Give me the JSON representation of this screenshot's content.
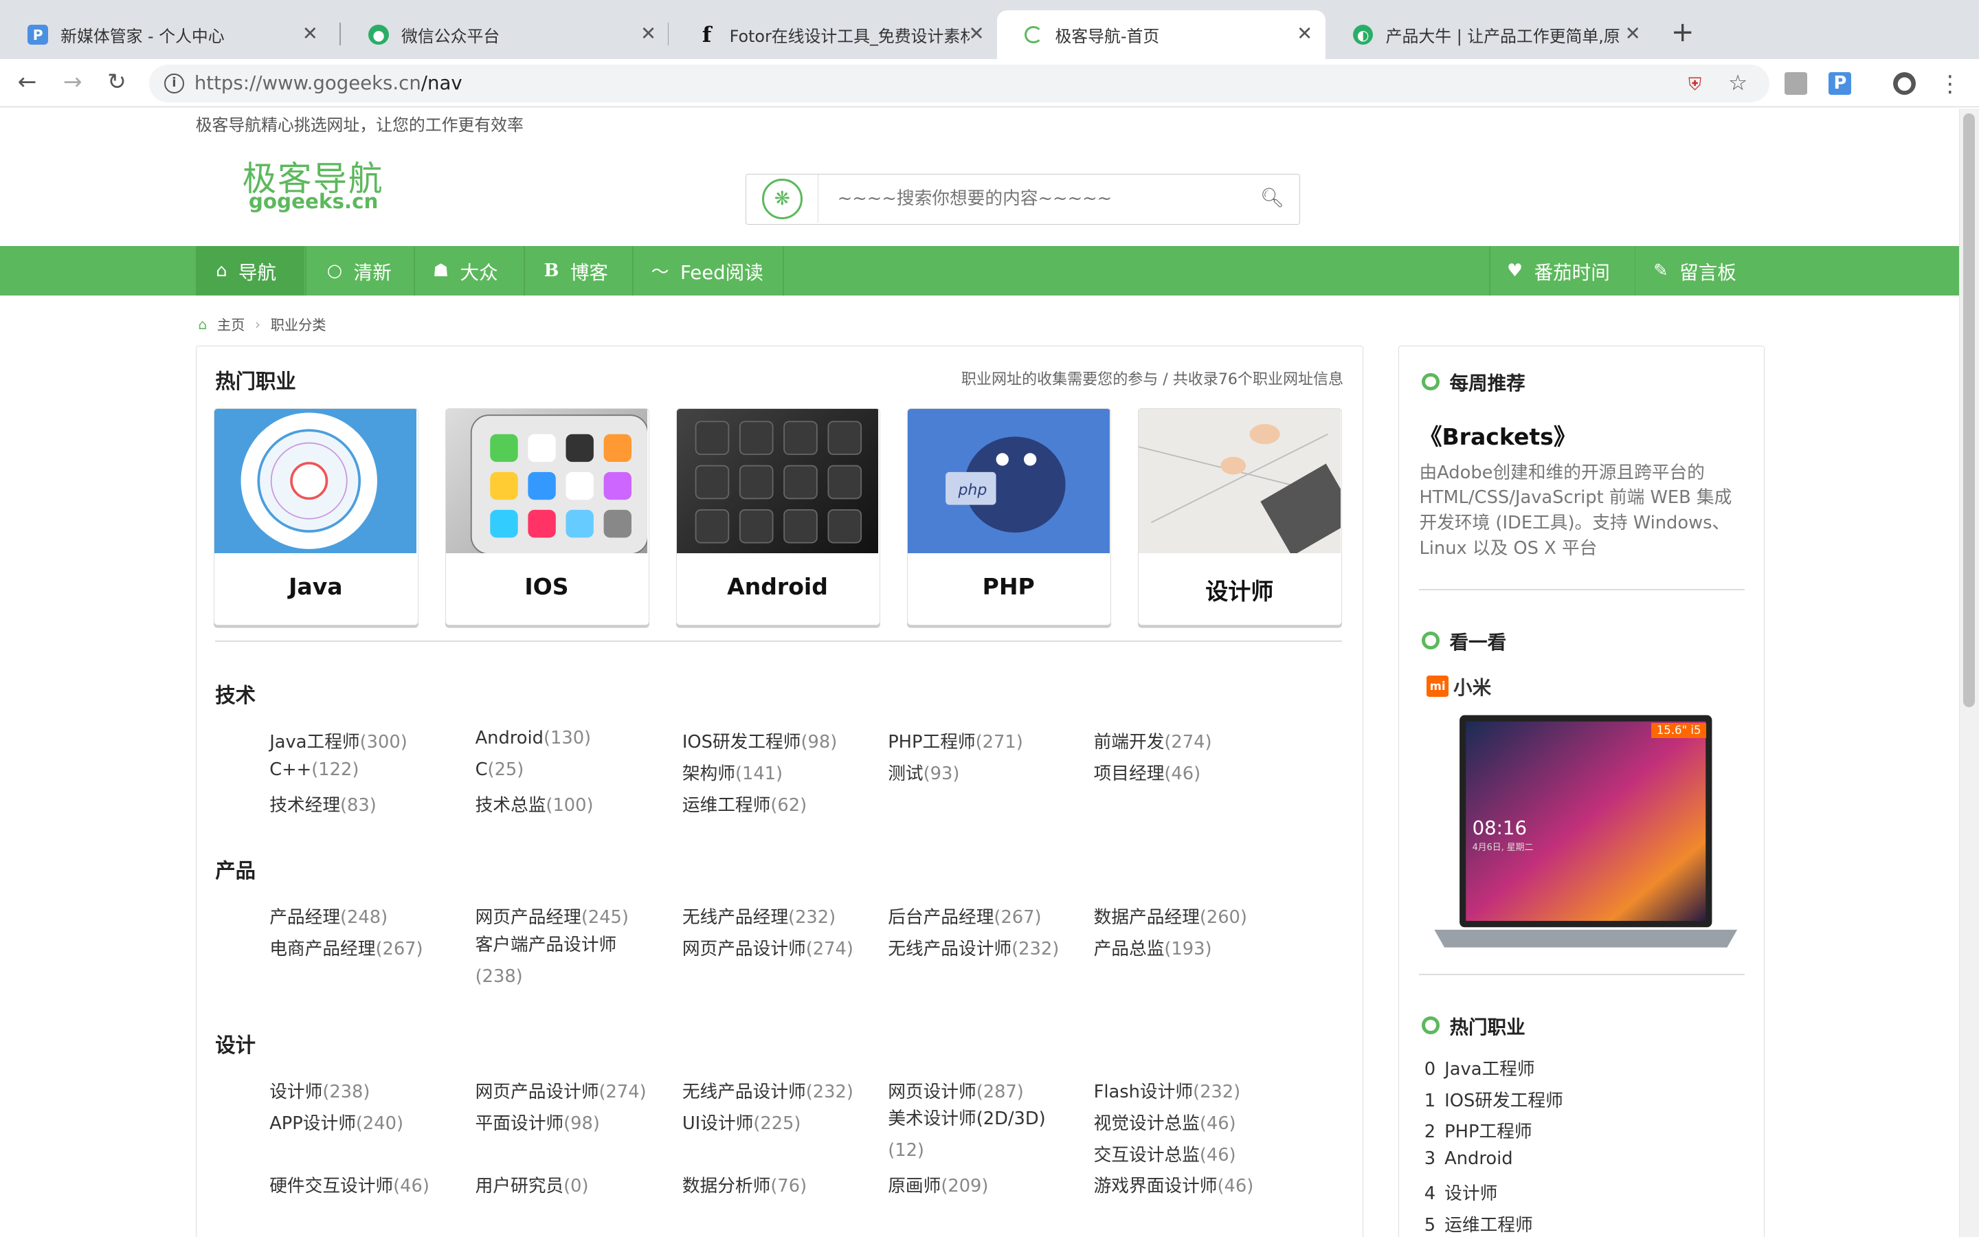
{
  "browser": {
    "tabs": [
      {
        "title": "新媒体管家 - 个人中心",
        "icon": "P",
        "color": "#4a90e2"
      },
      {
        "title": "微信公众平台",
        "icon": "wechat",
        "color": "#2aae67"
      },
      {
        "title": "Fotor在线设计工具_免费设计素材",
        "icon": "f",
        "color": "#111111"
      },
      {
        "title": "极客导航-首页",
        "icon": "loading",
        "color": "#5cb85c"
      },
      {
        "title": "产品大牛 | 让产品工作更简单,原",
        "icon": "pd",
        "color": "#2aae67"
      }
    ],
    "url_host": "https://www.gogeeks.cn",
    "url_path": "/nav"
  },
  "header": {
    "slogan": "极客导航精心挑选网址，让您的工作更有效率",
    "logo_cn": "极客导航",
    "logo_en": "gogeeks.cn",
    "search_placeholder": "~~~~搜索你想要的内容~~~~~"
  },
  "nav": {
    "left": [
      {
        "label": "导航",
        "icon": "home-icon"
      },
      {
        "label": "清新",
        "icon": "circle-icon"
      },
      {
        "label": "大众",
        "icon": "users-icon"
      },
      {
        "label": "博客",
        "icon": "b-icon"
      },
      {
        "label": "Feed阅读",
        "icon": "rss-icon"
      }
    ],
    "right": [
      {
        "label": "番茄时间",
        "icon": "heart-icon"
      },
      {
        "label": "留言板",
        "icon": "edit-icon"
      }
    ]
  },
  "breadcrumb": {
    "home": "主页",
    "current": "职业分类"
  },
  "hot": {
    "title": "热门职业",
    "note": "职业网址的收集需要您的参与 / 共收录76个职业网址信息",
    "cards": [
      {
        "label": "Java"
      },
      {
        "label": "IOS"
      },
      {
        "label": "Android"
      },
      {
        "label": "PHP"
      },
      {
        "label": "设计师"
      }
    ]
  },
  "sections": [
    {
      "title": "技术",
      "items": [
        {
          "name": "Java工程师",
          "count": "(300)"
        },
        {
          "name": "Android",
          "count": "(130)"
        },
        {
          "name": "IOS研发工程师",
          "count": "(98)"
        },
        {
          "name": "PHP工程师",
          "count": "(271)"
        },
        {
          "name": "前端开发",
          "count": "(274)"
        },
        {
          "name": "C++",
          "count": "(122)"
        },
        {
          "name": "C",
          "count": "(25)"
        },
        {
          "name": "架构师",
          "count": "(141)"
        },
        {
          "name": "测试",
          "count": "(93)"
        },
        {
          "name": "项目经理",
          "count": "(46)"
        },
        {
          "name": "技术经理",
          "count": "(83)"
        },
        {
          "name": "技术总监",
          "count": "(100)"
        },
        {
          "name": "运维工程师",
          "count": "(62)"
        }
      ]
    },
    {
      "title": "产品",
      "items": [
        {
          "name": "产品经理",
          "count": "(248)"
        },
        {
          "name": "网页产品经理",
          "count": "(245)"
        },
        {
          "name": "无线产品经理",
          "count": "(232)"
        },
        {
          "name": "后台产品经理",
          "count": "(267)"
        },
        {
          "name": "数据产品经理",
          "count": "(260)"
        },
        {
          "name": "电商产品经理",
          "count": "(267)"
        },
        {
          "name": "客户端产品设计师",
          "count": "(238)"
        },
        {
          "name": "网页产品设计师",
          "count": "(274)"
        },
        {
          "name": "无线产品设计师",
          "count": "(232)"
        },
        {
          "name": "产品总监",
          "count": "(193)"
        }
      ]
    },
    {
      "title": "设计",
      "items": [
        {
          "name": "设计师",
          "count": "(238)"
        },
        {
          "name": "网页产品设计师",
          "count": "(274)"
        },
        {
          "name": "无线产品设计师",
          "count": "(232)"
        },
        {
          "name": "网页设计师",
          "count": "(287)"
        },
        {
          "name": "Flash设计师",
          "count": "(232)"
        },
        {
          "name": "APP设计师",
          "count": "(240)"
        },
        {
          "name": "平面设计师",
          "count": "(98)"
        },
        {
          "name": "UI设计师",
          "count": "(225)"
        },
        {
          "name": "美术设计师(2D/3D)",
          "count": "(12)"
        },
        {
          "name": "视觉设计总监",
          "count": "(46)"
        },
        {
          "name": "交互设计总监",
          "count": "(46)"
        },
        {
          "name": "硬件交互设计师",
          "count": "(46)"
        },
        {
          "name": "用户研究员",
          "count": "(0)"
        },
        {
          "name": "数据分析师",
          "count": "(76)"
        },
        {
          "name": "原画师",
          "count": "(209)"
        },
        {
          "name": "游戏界面设计师",
          "count": "(46)"
        }
      ]
    }
  ],
  "sidebar": {
    "weekly_title": "每周推荐",
    "weekly_pick": "《Brackets》",
    "weekly_desc": "由Adobe创建和维的开源且跨平台的HTML/CSS/JavaScript 前端 WEB 集成开发环境 (IDE工具)。支持 Windows、Linux 以及 OS X 平台",
    "look_title": "看一看",
    "ad_brand": "小米",
    "ad_brand_logo": "mi",
    "ad_badge": "15.6\" i5",
    "ad_time": "08:16",
    "ad_date": "4月6日, 星期二",
    "hot_title": "热门职业",
    "hot_list": [
      {
        "i": "0",
        "name": "Java工程师"
      },
      {
        "i": "1",
        "name": "IOS研发工程师"
      },
      {
        "i": "2",
        "name": "PHP工程师"
      },
      {
        "i": "3",
        "name": "Android"
      },
      {
        "i": "4",
        "name": "设计师"
      },
      {
        "i": "5",
        "name": "运维工程师"
      }
    ]
  },
  "colors": {
    "accent": "#5cb85c",
    "nav_active": "#4ca74c",
    "count_gray": "#888888"
  }
}
